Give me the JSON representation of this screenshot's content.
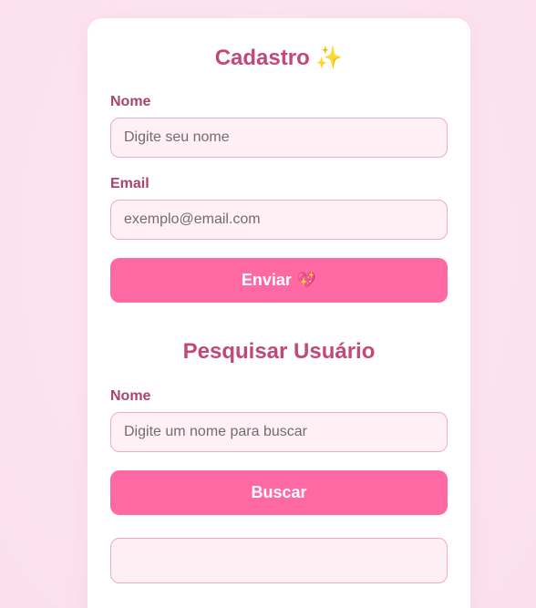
{
  "cadastro": {
    "title": "Cadastro",
    "title_icon": "sparkles-icon",
    "name_label": "Nome",
    "name_placeholder": "Digite seu nome",
    "email_label": "Email",
    "email_placeholder": "exemplo@email.com",
    "submit_label": "Enviar",
    "submit_icon": "sparkling-heart-icon"
  },
  "pesquisa": {
    "title": "Pesquisar Usuário",
    "name_label": "Nome",
    "name_placeholder": "Digite um nome para buscar",
    "search_label": "Buscar",
    "result_text": ""
  },
  "colors": {
    "accent": "#ff69a3",
    "heading": "#c0497a",
    "label": "#a8446f",
    "input_bg": "#fff0f5",
    "input_border": "#f0a9c6"
  }
}
